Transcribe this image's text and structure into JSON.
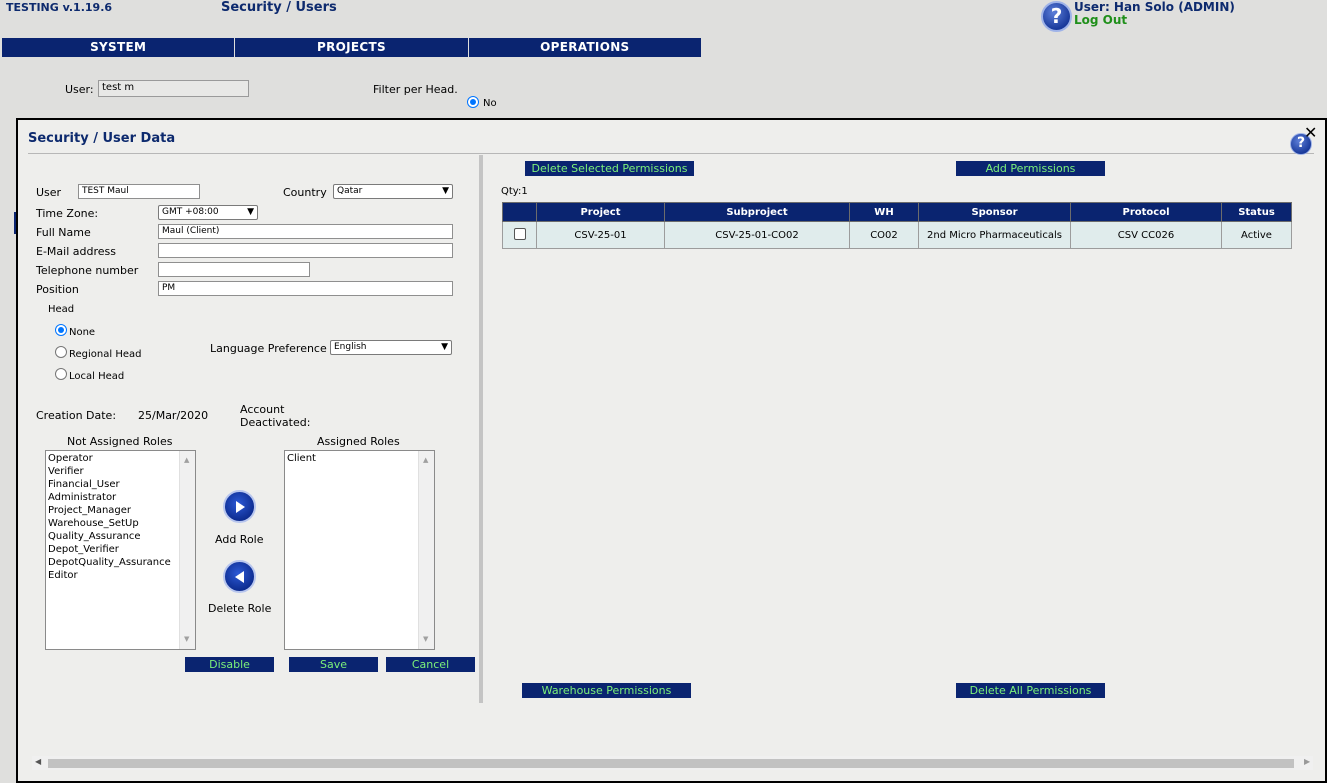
{
  "header": {
    "app_version": "TESTING v.1.19.6",
    "page_crumb": "Security / Users",
    "help_glyph": "?",
    "user_label": "User: Han Solo (ADMIN)",
    "logout_label": "Log Out"
  },
  "nav": {
    "items": [
      "SYSTEM",
      "PROJECTS",
      "OPERATIONS"
    ]
  },
  "background_form": {
    "user_label": "User:",
    "user_value": "test m",
    "filter_label": "Filter per Head.",
    "filter_no_label": "No"
  },
  "modal": {
    "title": "Security / User Data",
    "close_glyph": "✕",
    "form": {
      "user_label": "User",
      "user_value": "TEST Maul",
      "country_label": "Country",
      "country_value": "Qatar",
      "timezone_label": "Time Zone:",
      "timezone_value": "GMT +08:00",
      "fullname_label": "Full Name",
      "fullname_value": "Maul (Client)",
      "email_label": "E-Mail address",
      "email_value": "",
      "phone_label": "Telephone number",
      "phone_value": "",
      "position_label": "Position",
      "position_value": "PM",
      "head_label": "Head",
      "head_options": [
        "None",
        "Regional Head",
        "Local Head"
      ],
      "head_selected": "None",
      "language_label": "Language Preference",
      "language_value": "English",
      "creation_label": "Creation Date:",
      "creation_value": "25/Mar/2020",
      "deactivated_label_1": "Account",
      "deactivated_label_2": "Deactivated:"
    },
    "roles": {
      "not_assigned_label": "Not Assigned Roles",
      "assigned_label": "Assigned Roles",
      "not_assigned": [
        "Operator",
        "Verifier",
        "Financial_User",
        "Administrator",
        "Project_Manager",
        "Warehouse_SetUp",
        "Quality_Assurance",
        "Depot_Verifier",
        "DepotQuality_Assurance",
        "Editor"
      ],
      "assigned": [
        "Client"
      ],
      "add_label": "Add Role",
      "delete_label": "Delete Role"
    },
    "actions": {
      "disable": "Disable",
      "save": "Save",
      "cancel": "Cancel"
    },
    "permissions": {
      "delete_selected": "Delete Selected Permissions",
      "add": "Add Permissions",
      "qty": "Qty:1",
      "columns": [
        "",
        "Project",
        "Subproject",
        "WH",
        "Sponsor",
        "Protocol",
        "Status"
      ],
      "rows": [
        {
          "project": "CSV-25-01",
          "subproject": "CSV-25-01-CO02",
          "wh": "CO02",
          "sponsor": "2nd Micro Pharmaceuticals",
          "protocol": "CSV CC026",
          "status": "Active"
        }
      ],
      "warehouse": "Warehouse Permissions",
      "delete_all": "Delete All Permissions"
    }
  },
  "icons": {
    "help": "help-question-icon",
    "close": "close-icon",
    "add_role": "arrow-right-circle-icon",
    "delete_role": "arrow-left-circle-icon",
    "dropdown": "chevron-down-icon"
  },
  "colors": {
    "navy": "#0a2470",
    "button_text": "#7cf07a",
    "logout": "#1f8f1a",
    "radio_blue": "#0075ff",
    "row_bg": "#e0ecec"
  }
}
